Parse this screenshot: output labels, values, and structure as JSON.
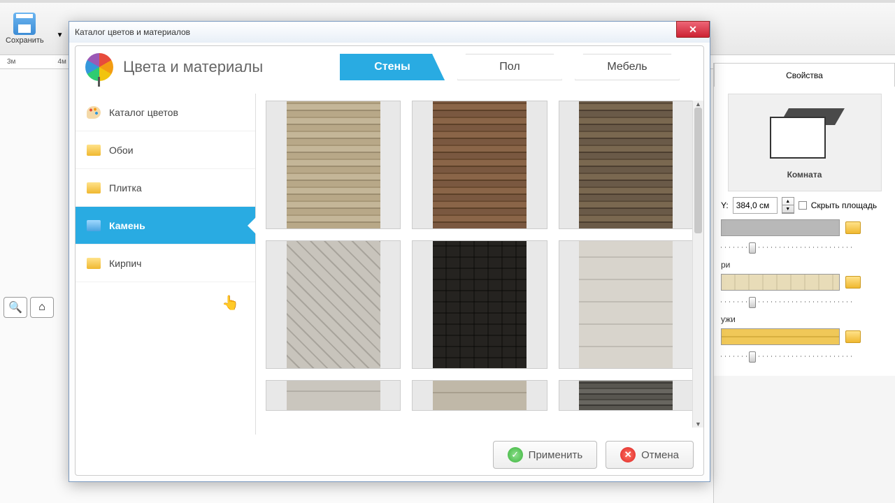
{
  "app": {
    "save_label": "Сохранить",
    "ruler": {
      "m3": "3м",
      "m4": "4м"
    }
  },
  "props": {
    "tab_label": "Свойства",
    "room_label": "Комната",
    "y_label": "Y:",
    "y_value": "384,0 см",
    "hide_area": "Скрыть площадь",
    "section_inside": "ри",
    "section_outside": "ужи"
  },
  "dialog": {
    "title": "Каталог цветов и материалов",
    "header_title": "Цвета и материалы",
    "tabs": {
      "walls": "Стены",
      "floor": "Пол",
      "furniture": "Мебель"
    },
    "sidebar": {
      "colors": "Каталог цветов",
      "wallpaper": "Обои",
      "tile": "Плитка",
      "stone": "Камень",
      "brick": "Кирпич"
    },
    "buttons": {
      "apply": "Применить",
      "cancel": "Отмена"
    }
  }
}
